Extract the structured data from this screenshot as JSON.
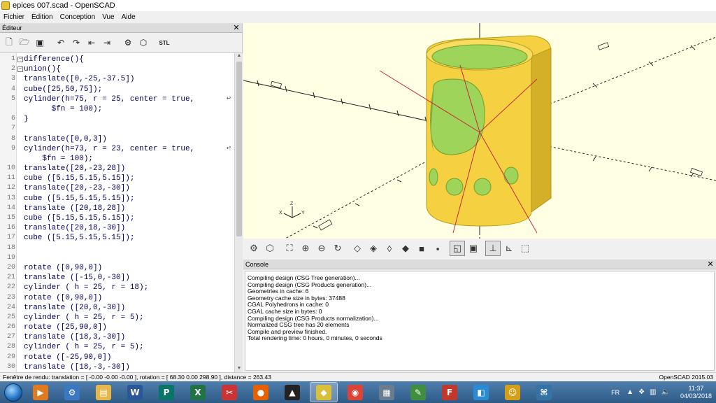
{
  "window": {
    "title": "epices 007.scad - OpenSCAD"
  },
  "menu": {
    "items": [
      "Fichier",
      "Édition",
      "Conception",
      "Vue",
      "Aide"
    ]
  },
  "editor": {
    "title": "Éditeur",
    "close": "✕",
    "toolbar": [
      "new-icon",
      "open-icon",
      "save-icon",
      "undo-icon",
      "redo-icon",
      "unindent-icon",
      "indent-icon",
      "preview-icon",
      "render-icon",
      "export-stl-icon"
    ],
    "stl_label": "STL",
    "lines": [
      {
        "n": "1",
        "code": "difference(){",
        "fold": "−"
      },
      {
        "n": "2",
        "code": "union(){",
        "fold": "−"
      },
      {
        "n": "3",
        "code": "translate([0,-25,-37.5])"
      },
      {
        "n": "4",
        "code": "cube([25,50,75]);"
      },
      {
        "n": "5",
        "code": "cylinder(h=75, r = 25, center = true,",
        "wrap": true
      },
      {
        "n": "",
        "code": "      $fn = 100);"
      },
      {
        "n": "6",
        "code": "}"
      },
      {
        "n": "7",
        "code": ""
      },
      {
        "n": "8",
        "code": "translate([0,0,3])"
      },
      {
        "n": "9",
        "code": "cylinder(h=73, r = 23, center = true,",
        "wrap": true
      },
      {
        "n": "",
        "code": "    $fn = 100);"
      },
      {
        "n": "10",
        "code": "translate([20,-23,28])"
      },
      {
        "n": "11",
        "code": "cube ([5.15,5.15,5.15]);"
      },
      {
        "n": "12",
        "code": "translate([20,-23,-30])"
      },
      {
        "n": "13",
        "code": "cube ([5.15,5.15,5.15]);"
      },
      {
        "n": "14",
        "code": "translate ([20,18,28])"
      },
      {
        "n": "15",
        "code": "cube ([5.15,5.15,5.15]);"
      },
      {
        "n": "16",
        "code": "translate([20,18,-30])"
      },
      {
        "n": "17",
        "code": "cube ([5.15,5.15,5.15]);"
      },
      {
        "n": "18",
        "code": ""
      },
      {
        "n": "19",
        "code": ""
      },
      {
        "n": "20",
        "code": "rotate ([0,90,0])"
      },
      {
        "n": "21",
        "code": "translate ([-15,0,-30])"
      },
      {
        "n": "22",
        "code": "cylinder ( h = 25, r = 18);"
      },
      {
        "n": "23",
        "code": "rotate ([0,90,0])"
      },
      {
        "n": "24",
        "code": "translate ([20,0,-30])"
      },
      {
        "n": "25",
        "code": "cylinder ( h = 25, r = 5);"
      },
      {
        "n": "26",
        "code": "rotate ([25,90,0])"
      },
      {
        "n": "27",
        "code": "translate ([18,3,-30])"
      },
      {
        "n": "28",
        "code": "cylinder ( h = 25, r = 5);"
      },
      {
        "n": "29",
        "code": "rotate ([-25,90,0])"
      },
      {
        "n": "30",
        "code": "translate ([18,-3,-30])"
      }
    ]
  },
  "viewport": {
    "background": "#ffffe4",
    "model_color": "#f5d142",
    "axis_labels": [
      "Z",
      "Y",
      "X"
    ]
  },
  "view_toolbar": [
    "preview-icon",
    "render-icon",
    "view-all-icon",
    "zoom-in-icon",
    "zoom-out-icon",
    "reset-view-icon",
    "view-right-icon",
    "view-top-icon",
    "view-bottom-icon",
    "view-left-icon",
    "view-front-icon",
    "view-back-icon",
    "perspective-icon",
    "orthogonal-icon",
    "show-axes-icon",
    "show-scale-icon",
    "show-edges-icon"
  ],
  "console": {
    "title": "Console",
    "lines": [
      "Compiling design (CSG Tree generation)...",
      "Compiling design (CSG Products generation)...",
      "Geometries in cache: 6",
      "Geometry cache size in bytes: 37488",
      "CGAL Polyhedrons in cache: 0",
      "CGAL cache size in bytes: 0",
      "Compiling design (CSG Products normalization)...",
      "Normalized CSG tree has 20 elements",
      "Compile and preview finished.",
      "Total rendering time: 0 hours, 0 minutes, 0 seconds"
    ]
  },
  "status": {
    "left": "Fenêtre de rendu: translation = [ -0.00 -0.00 -0.00 ], rotation = [ 68.30 0.00 298.90 ], distance = 263.43",
    "right": "OpenSCAD 2015.03"
  },
  "taskbar": {
    "apps": [
      {
        "name": "media-player",
        "color": "#e07a1f",
        "glyph": "▶"
      },
      {
        "name": "control-panel",
        "color": "#3a78c2",
        "glyph": "⚙"
      },
      {
        "name": "file-explorer",
        "color": "#e6b84a",
        "glyph": "▤"
      },
      {
        "name": "word",
        "color": "#2b579a",
        "glyph": "W"
      },
      {
        "name": "publisher",
        "color": "#077568",
        "glyph": "P"
      },
      {
        "name": "excel",
        "color": "#217346",
        "glyph": "X"
      },
      {
        "name": "snipping-tool",
        "color": "#cc3333",
        "glyph": "✂"
      },
      {
        "name": "firefox",
        "color": "#e66000",
        "glyph": "●"
      },
      {
        "name": "inkscape",
        "color": "#222222",
        "glyph": "▲"
      },
      {
        "name": "openscad",
        "color": "#d8c03a",
        "glyph": "◆"
      },
      {
        "name": "chrome",
        "color": "#db4437",
        "glyph": "◉"
      },
      {
        "name": "calculator",
        "color": "#6a7d90",
        "glyph": "▦"
      },
      {
        "name": "notepad",
        "color": "#3f8f3f",
        "glyph": "✎"
      },
      {
        "name": "filezilla",
        "color": "#c0392b",
        "glyph": "F"
      },
      {
        "name": "paint",
        "color": "#2a8ad4",
        "glyph": "◧"
      },
      {
        "name": "game",
        "color": "#d4a017",
        "glyph": "☺"
      },
      {
        "name": "python",
        "color": "#3572a5",
        "glyph": "⌘"
      }
    ],
    "lang": "FR",
    "time": "11:37",
    "date": "04/03/2018"
  }
}
